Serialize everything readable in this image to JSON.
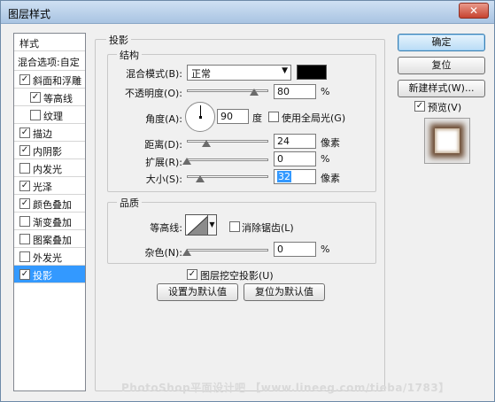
{
  "window": {
    "title": "图层样式",
    "close_glyph": "✕"
  },
  "styles_panel": {
    "header": "样式",
    "blend_options": "混合选项:自定",
    "items": [
      {
        "label": "斜面和浮雕",
        "checked": true,
        "indent": false
      },
      {
        "label": "等高线",
        "checked": true,
        "indent": true
      },
      {
        "label": "纹理",
        "checked": false,
        "indent": true
      },
      {
        "label": "描边",
        "checked": true,
        "indent": false
      },
      {
        "label": "内阴影",
        "checked": true,
        "indent": false
      },
      {
        "label": "内发光",
        "checked": false,
        "indent": false
      },
      {
        "label": "光泽",
        "checked": true,
        "indent": false
      },
      {
        "label": "颜色叠加",
        "checked": true,
        "indent": false
      },
      {
        "label": "渐变叠加",
        "checked": false,
        "indent": false
      },
      {
        "label": "图案叠加",
        "checked": false,
        "indent": false
      },
      {
        "label": "外发光",
        "checked": false,
        "indent": false
      },
      {
        "label": "投影",
        "checked": true,
        "indent": false,
        "selected": true
      }
    ]
  },
  "drop_shadow": {
    "title": "投影",
    "structure": {
      "legend": "结构",
      "blend_mode_label": "混合模式(B):",
      "blend_mode_value": "正常",
      "shadow_color": "#000000",
      "opacity_label": "不透明度(O):",
      "opacity_value": "80",
      "opacity_unit": "%",
      "opacity_percent": 80,
      "angle_label": "角度(A):",
      "angle_value": "90",
      "angle_unit": "度",
      "global_light_label": "使用全局光(G)",
      "global_light_checked": false,
      "distance_label": "距离(D):",
      "distance_value": "24",
      "distance_unit": "像素",
      "spread_label": "扩展(R):",
      "spread_value": "0",
      "spread_unit": "%",
      "size_label": "大小(S):",
      "size_value": "32",
      "size_unit": "像素"
    },
    "quality": {
      "legend": "品质",
      "contour_label": "等高线:",
      "anti_alias_label": "消除锯齿(L)",
      "anti_alias_checked": false,
      "noise_label": "杂色(N):",
      "noise_value": "0",
      "noise_unit": "%"
    },
    "knockout_label": "图层挖空投影(U)",
    "knockout_checked": true,
    "make_default_label": "设置为默认值",
    "reset_default_label": "复位为默认值"
  },
  "buttons": {
    "ok": "确定",
    "reset": "复位",
    "new_style": "新建样式(W)...",
    "preview_label": "预览(V)",
    "preview_checked": true
  },
  "watermark": "PhotoShop平面设计吧 【www.lineeg.com/tieba/1783】"
}
